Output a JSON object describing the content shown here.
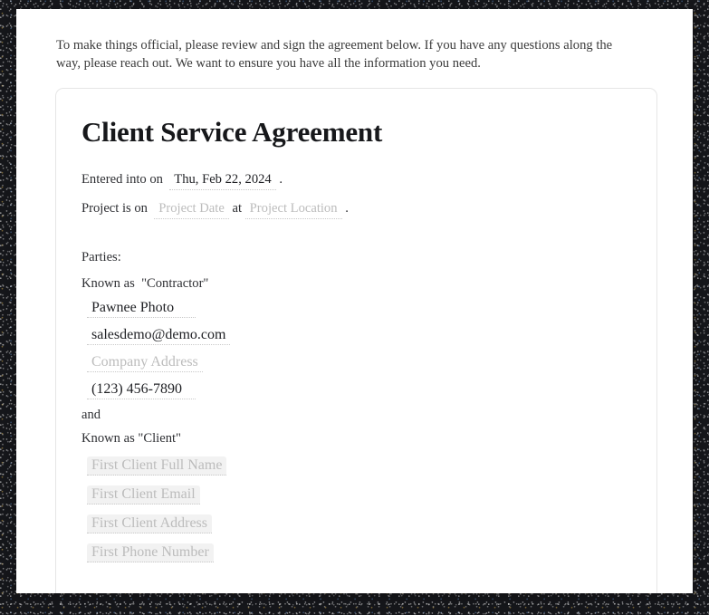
{
  "intro": {
    "text": "To make things official, please review and sign the agreement below. If you have any questions along the way, please reach out. We want to ensure you have all the information you need."
  },
  "agreement": {
    "title": "Client Service Agreement",
    "entered": {
      "label": "Entered into on",
      "date_value": "Thu, Feb 22, 2024",
      "period": "."
    },
    "project": {
      "label": "Project is on",
      "date_placeholder": "Project Date",
      "at_label": "at",
      "location_placeholder": "Project Location",
      "period": "."
    },
    "parties": {
      "heading": "Parties:",
      "contractor_known_as": "Known as  \"Contractor\"",
      "contractor": {
        "name": "Pawnee Photo",
        "email": "salesdemo@demo.com",
        "address_placeholder": "Company Address",
        "phone": "(123) 456-7890"
      },
      "and": "and",
      "client_known_as": "Known as \"Client\"",
      "client": {
        "name_placeholder": "First Client Full Name",
        "email_placeholder": "First Client Email",
        "address_placeholder": "First Client Address",
        "phone_placeholder": "First Phone Number"
      }
    }
  },
  "colors": {
    "text": "#2e2f33",
    "title": "#17181b",
    "placeholder": "#bcbcbc",
    "underline": "#c9c9c9",
    "highlight": "#f2f2f2",
    "card_border": "#e6e6e6"
  }
}
